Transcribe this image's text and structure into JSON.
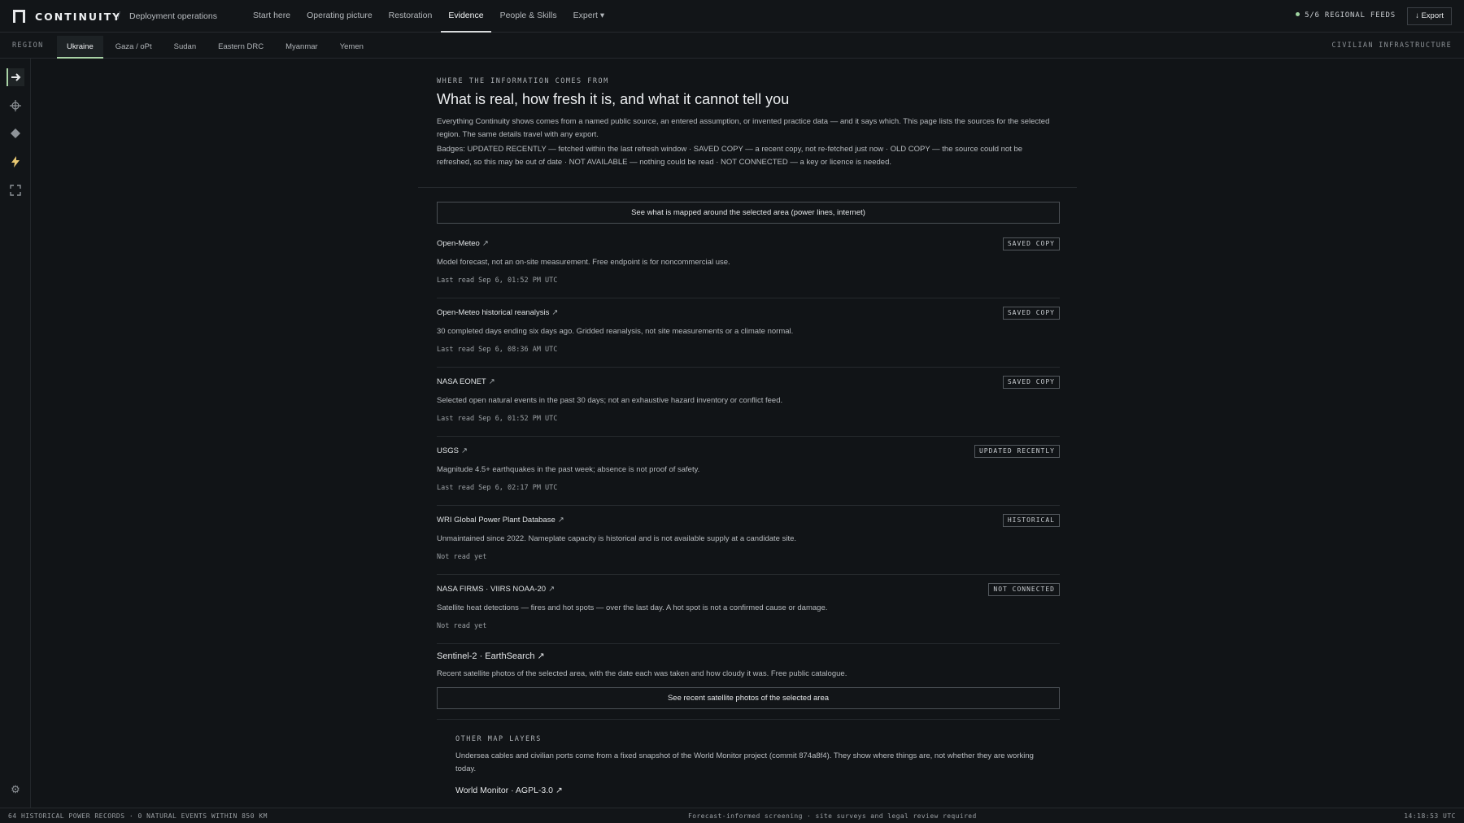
{
  "app": {
    "brand": "CONTINUITY",
    "breadcrumb_sep": "/",
    "breadcrumb": "Deployment operations"
  },
  "nav": {
    "items": [
      {
        "label": "Start here"
      },
      {
        "label": "Operating picture"
      },
      {
        "label": "Restoration"
      },
      {
        "label": "Evidence",
        "active": true
      },
      {
        "label": "People & Skills"
      },
      {
        "label": "Expert ▾"
      }
    ]
  },
  "header": {
    "feeds": "5/6 REGIONAL FEEDS",
    "export_label": "↓ Export",
    "feed_status_color": "#9fd3a0"
  },
  "region": {
    "label": "REGION",
    "tabs": [
      "Ukraine",
      "Gaza / oPt",
      "Sudan",
      "Eastern DRC",
      "Myanmar",
      "Yemen"
    ],
    "active": "Ukraine",
    "right_label": "CIVILIAN INFRASTRUCTURE"
  },
  "rail": {
    "icons": [
      "arrow-right-icon",
      "crosshair-icon",
      "diamond-icon",
      "lightning-icon",
      "expand-icon"
    ],
    "settings_icon": "gear-icon"
  },
  "main": {
    "kicker": "WHERE THE INFORMATION COMES FROM",
    "title": "What is real, how fresh it is, and what it cannot tell you",
    "intro": "Everything Continuity shows comes from a named public source, an entered assumption, or invented practice data — and it says which. This page lists the sources for the selected region. The same details travel with any export.",
    "badges_note": "Badges: UPDATED RECENTLY — fetched within the last refresh window · SAVED COPY — a recent copy, not re-fetched just now · OLD COPY — the source could not be refreshed, so this may be out of date · NOT AVAILABLE — nothing could be read · NOT CONNECTED — a key or licence is needed.",
    "map_button": "See what is mapped around the selected area (power lines, internet)",
    "ext_glyph": "↗",
    "sources": [
      {
        "name": "Open-Meteo",
        "desc": "Model forecast, not an on-site measurement. Free endpoint is for noncommercial use.",
        "read": "Last read Sep 6, 01:52 PM UTC",
        "badge": "SAVED COPY"
      },
      {
        "name": "Open-Meteo historical reanalysis",
        "desc": "30 completed days ending six days ago. Gridded reanalysis, not site measurements or a climate normal.",
        "read": "Last read Sep 6, 08:36 AM UTC",
        "badge": "SAVED COPY"
      },
      {
        "name": "NASA EONET",
        "desc": "Selected open natural events in the past 30 days; not an exhaustive hazard inventory or conflict feed.",
        "read": "Last read Sep 6, 01:52 PM UTC",
        "badge": "SAVED COPY"
      },
      {
        "name": "USGS",
        "desc": "Magnitude 4.5+ earthquakes in the past week; absence is not proof of safety.",
        "read": "Last read Sep 6, 02:17 PM UTC",
        "badge": "UPDATED RECENTLY"
      },
      {
        "name": "WRI Global Power Plant Database",
        "desc": "Unmaintained since 2022. Nameplate capacity is historical and is not available supply at a candidate site.",
        "read": "Not read yet",
        "badge": "HISTORICAL"
      },
      {
        "name": "NASA FIRMS · VIIRS NOAA-20",
        "desc": "Satellite heat detections — fires and hot spots — over the last day. A hot spot is not a confirmed cause or damage.",
        "read": "Not read yet",
        "badge": "NOT CONNECTED"
      }
    ],
    "sentinel": {
      "name": "Sentinel-2 · EarthSearch",
      "desc": "Recent satellite photos of the selected area, with the date each was taken and how cloudy it was. Free public catalogue.",
      "button": "See recent satellite photos of the selected area"
    },
    "other_layers": {
      "kicker": "OTHER MAP LAYERS",
      "desc": "Undersea cables and civilian ports come from a fixed snapshot of the World Monitor project (commit 874a8f4). They show where things are, not whether they are working today.",
      "link": "World Monitor · AGPL-3.0"
    }
  },
  "status": {
    "left": "64 HISTORICAL POWER RECORDS · 0 NATURAL EVENTS WITHIN 850 KM",
    "middle": "Forecast-informed screening · site surveys and legal review required",
    "right": "14:18:53 UTC"
  }
}
